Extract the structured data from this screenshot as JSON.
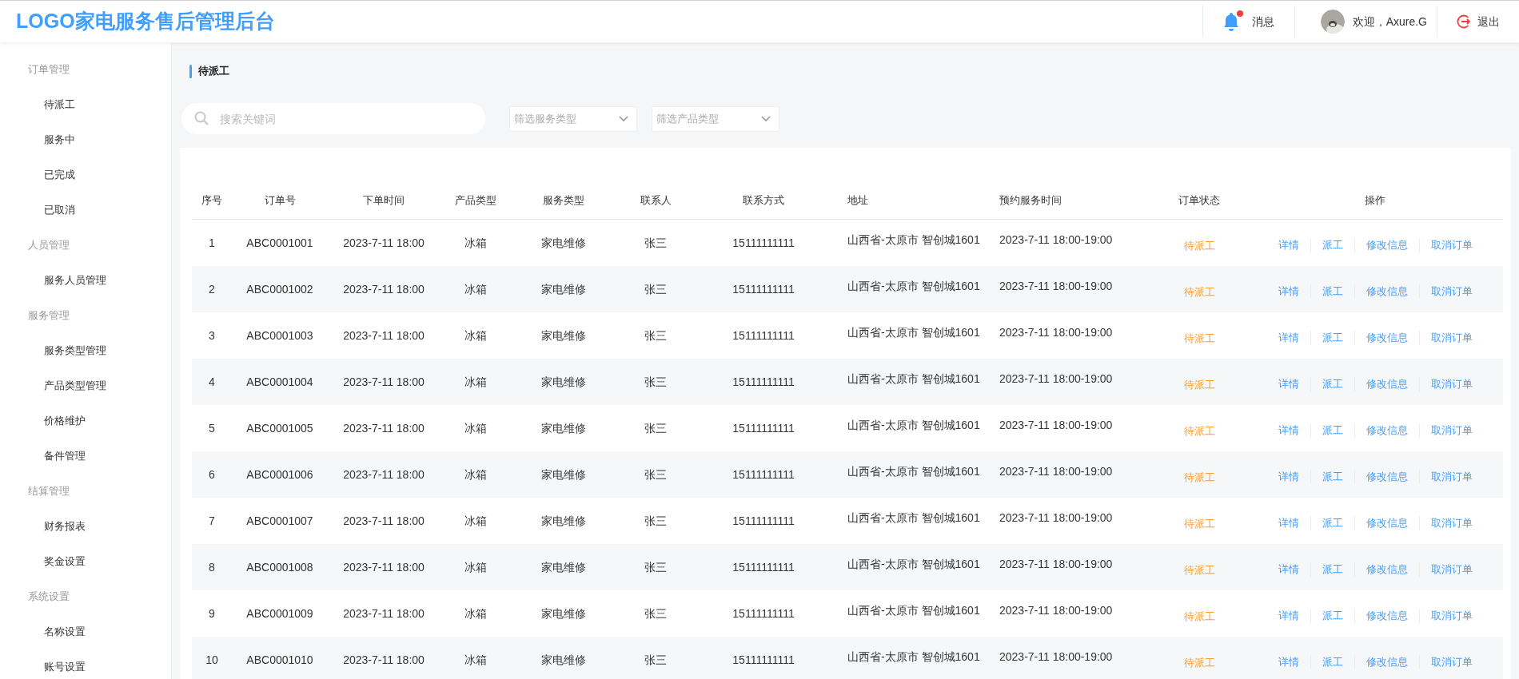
{
  "header": {
    "logo": "LOGO家电服务售后管理后台",
    "notifications": {
      "label": "消息",
      "unread": true
    },
    "user": {
      "greeting": "欢迎，Axure.G"
    },
    "logout": "退出"
  },
  "sidebar": {
    "groups": [
      {
        "title": "订单管理",
        "items": [
          {
            "label": "待派工"
          },
          {
            "label": "服务中"
          },
          {
            "label": "已完成"
          },
          {
            "label": "已取消"
          }
        ]
      },
      {
        "title": "人员管理",
        "items": [
          {
            "label": "服务人员管理"
          }
        ]
      },
      {
        "title": "服务管理",
        "items": [
          {
            "label": "服务类型管理"
          },
          {
            "label": "产品类型管理"
          },
          {
            "label": "价格维护"
          },
          {
            "label": "备件管理"
          }
        ]
      },
      {
        "title": "结算管理",
        "items": [
          {
            "label": "财务报表"
          },
          {
            "label": "奖金设置"
          }
        ]
      },
      {
        "title": "系统设置",
        "items": [
          {
            "label": "名称设置"
          },
          {
            "label": "账号设置"
          }
        ]
      }
    ]
  },
  "page_title": "待派工",
  "filters": {
    "search": {
      "placeholder": "搜索关键词"
    },
    "selects": [
      {
        "placeholder": "筛选服务类型"
      },
      {
        "placeholder": "筛选产品类型"
      }
    ]
  },
  "table": {
    "columns": [
      "序号",
      "订单号",
      "下单时间",
      "产品类型",
      "服务类型",
      "联系人",
      "联系方式",
      "地址",
      "预约服务时间",
      "订单状态",
      "操作"
    ],
    "rows": [
      {
        "cells": [
          "1",
          "ABC0001001",
          "2023-7-11 18:00",
          "冰箱",
          "家电维修",
          "张三",
          "15111111111",
          "山西省-太原市 智创城1601",
          "2023-7-11 18:00-19:00",
          "待派工"
        ],
        "actions": [
          "详情",
          "派工",
          "修改信息",
          "取消订单"
        ]
      },
      {
        "cells": [
          "2",
          "ABC0001002",
          "2023-7-11 18:00",
          "冰箱",
          "家电维修",
          "张三",
          "15111111111",
          "山西省-太原市 智创城1601",
          "2023-7-11 18:00-19:00",
          "待派工"
        ],
        "actions": [
          "详情",
          "派工",
          "修改信息",
          "取消订单"
        ]
      },
      {
        "cells": [
          "3",
          "ABC0001003",
          "2023-7-11 18:00",
          "冰箱",
          "家电维修",
          "张三",
          "15111111111",
          "山西省-太原市 智创城1601",
          "2023-7-11 18:00-19:00",
          "待派工"
        ],
        "actions": [
          "详情",
          "派工",
          "修改信息",
          "取消订单"
        ]
      },
      {
        "cells": [
          "4",
          "ABC0001004",
          "2023-7-11 18:00",
          "冰箱",
          "家电维修",
          "张三",
          "15111111111",
          "山西省-太原市 智创城1601",
          "2023-7-11 18:00-19:00",
          "待派工"
        ],
        "actions": [
          "详情",
          "派工",
          "修改信息",
          "取消订单"
        ]
      },
      {
        "cells": [
          "5",
          "ABC0001005",
          "2023-7-11 18:00",
          "冰箱",
          "家电维修",
          "张三",
          "15111111111",
          "山西省-太原市 智创城1601",
          "2023-7-11 18:00-19:00",
          "待派工"
        ],
        "actions": [
          "详情",
          "派工",
          "修改信息",
          "取消订单"
        ]
      },
      {
        "cells": [
          "6",
          "ABC0001006",
          "2023-7-11 18:00",
          "冰箱",
          "家电维修",
          "张三",
          "15111111111",
          "山西省-太原市 智创城1601",
          "2023-7-11 18:00-19:00",
          "待派工"
        ],
        "actions": [
          "详情",
          "派工",
          "修改信息",
          "取消订单"
        ]
      },
      {
        "cells": [
          "7",
          "ABC0001007",
          "2023-7-11 18:00",
          "冰箱",
          "家电维修",
          "张三",
          "15111111111",
          "山西省-太原市 智创城1601",
          "2023-7-11 18:00-19:00",
          "待派工"
        ],
        "actions": [
          "详情",
          "派工",
          "修改信息",
          "取消订单"
        ]
      },
      {
        "cells": [
          "8",
          "ABC0001008",
          "2023-7-11 18:00",
          "冰箱",
          "家电维修",
          "张三",
          "15111111111",
          "山西省-太原市 智创城1601",
          "2023-7-11 18:00-19:00",
          "待派工"
        ],
        "actions": [
          "详情",
          "派工",
          "修改信息",
          "取消订单"
        ]
      },
      {
        "cells": [
          "9",
          "ABC0001009",
          "2023-7-11 18:00",
          "冰箱",
          "家电维修",
          "张三",
          "15111111111",
          "山西省-太原市 智创城1601",
          "2023-7-11 18:00-19:00",
          "待派工"
        ],
        "actions": [
          "详情",
          "派工",
          "修改信息",
          "取消订单"
        ]
      },
      {
        "cells": [
          "10",
          "ABC0001010",
          "2023-7-11 18:00",
          "冰箱",
          "家电维修",
          "张三",
          "15111111111",
          "山西省-太原市 智创城1601",
          "2023-7-11 18:00-19:00",
          "待派工"
        ],
        "actions": [
          "详情",
          "派工",
          "修改信息",
          "取消订单"
        ]
      }
    ]
  }
}
